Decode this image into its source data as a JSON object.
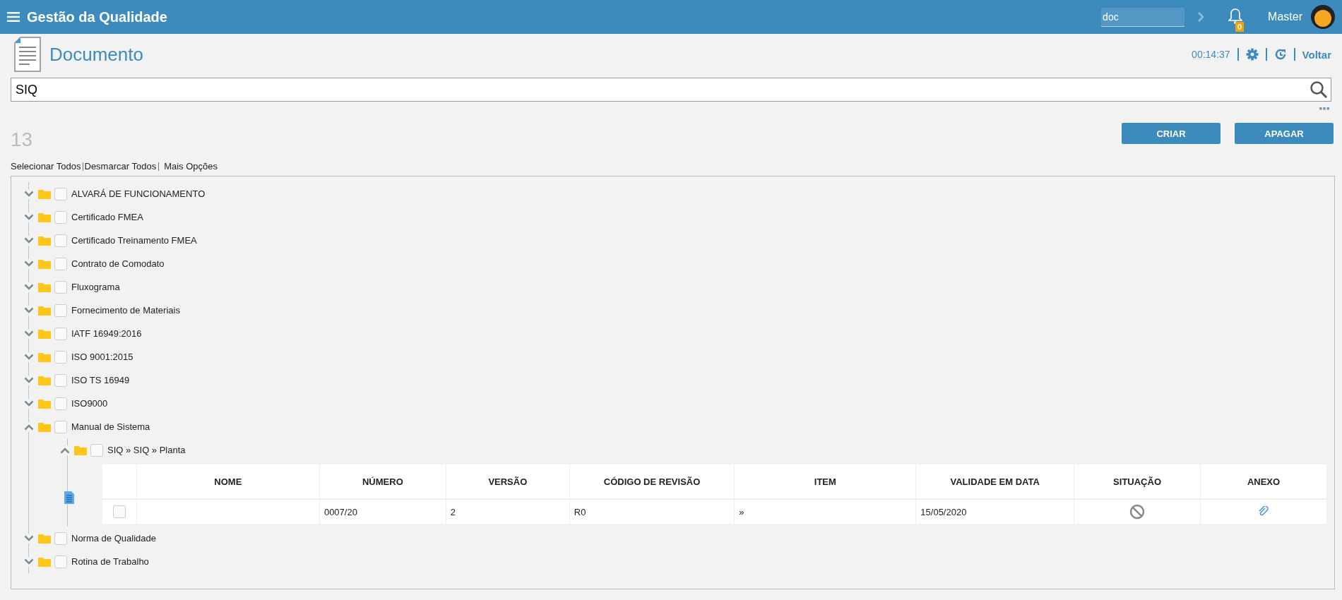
{
  "header": {
    "title": "Gestão da Qualidade",
    "search_value": "doc",
    "notification_count": "0",
    "user": "Master"
  },
  "page": {
    "title": "Documento",
    "timer": "00:14:37",
    "back_link": "Voltar"
  },
  "search": {
    "value": "SIQ"
  },
  "count": "13",
  "buttons": [
    "CRIAR",
    "APAGAR"
  ],
  "selection_links": [
    "Selecionar Todos",
    "Desmarcar Todos",
    "Mais Opções"
  ],
  "tree": [
    {
      "label": "ALVARÁ DE FUNCIONAMENTO",
      "expanded": false,
      "checked": false
    },
    {
      "label": "Certificado FMEA",
      "expanded": false,
      "checked": false
    },
    {
      "label": "Certificado Treinamento FMEA",
      "expanded": false,
      "checked": false
    },
    {
      "label": "Contrato de Comodato",
      "expanded": false,
      "checked": false
    },
    {
      "label": "Fluxograma",
      "expanded": false,
      "checked": false
    },
    {
      "label": "Fornecimento de Materiais",
      "expanded": false,
      "checked": false
    },
    {
      "label": "IATF 16949:2016",
      "expanded": false,
      "checked": false
    },
    {
      "label": "ISO 9001:2015",
      "expanded": false,
      "checked": false
    },
    {
      "label": "ISO TS 16949",
      "expanded": false,
      "checked": false
    },
    {
      "label": "ISO9000",
      "expanded": false,
      "checked": false
    },
    {
      "label": "Manual de Sistema",
      "expanded": true,
      "checked": false,
      "children": [
        {
          "label": "SIQ » SIQ » Planta",
          "expanded": true,
          "checked": false,
          "documents": {
            "columns": [
              "NOME",
              "NÚMERO",
              "VERSÃO",
              "CÓDIGO DE REVISÃO",
              "ITEM",
              "VALIDADE EM DATA",
              "SITUAÇÃO",
              "ANEXO"
            ],
            "rows": [
              {
                "checked": false,
                "numero": "0007/20",
                "versao": "2",
                "codigo_revisao": "R0",
                "item": "»",
                "validade": "15/05/2020",
                "blocked": true,
                "anexo": true
              }
            ]
          }
        }
      ]
    },
    {
      "label": "Norma de Qualidade",
      "expanded": false,
      "checked": false
    },
    {
      "label": "Rotina de Trabalho",
      "expanded": false,
      "checked": false
    }
  ]
}
